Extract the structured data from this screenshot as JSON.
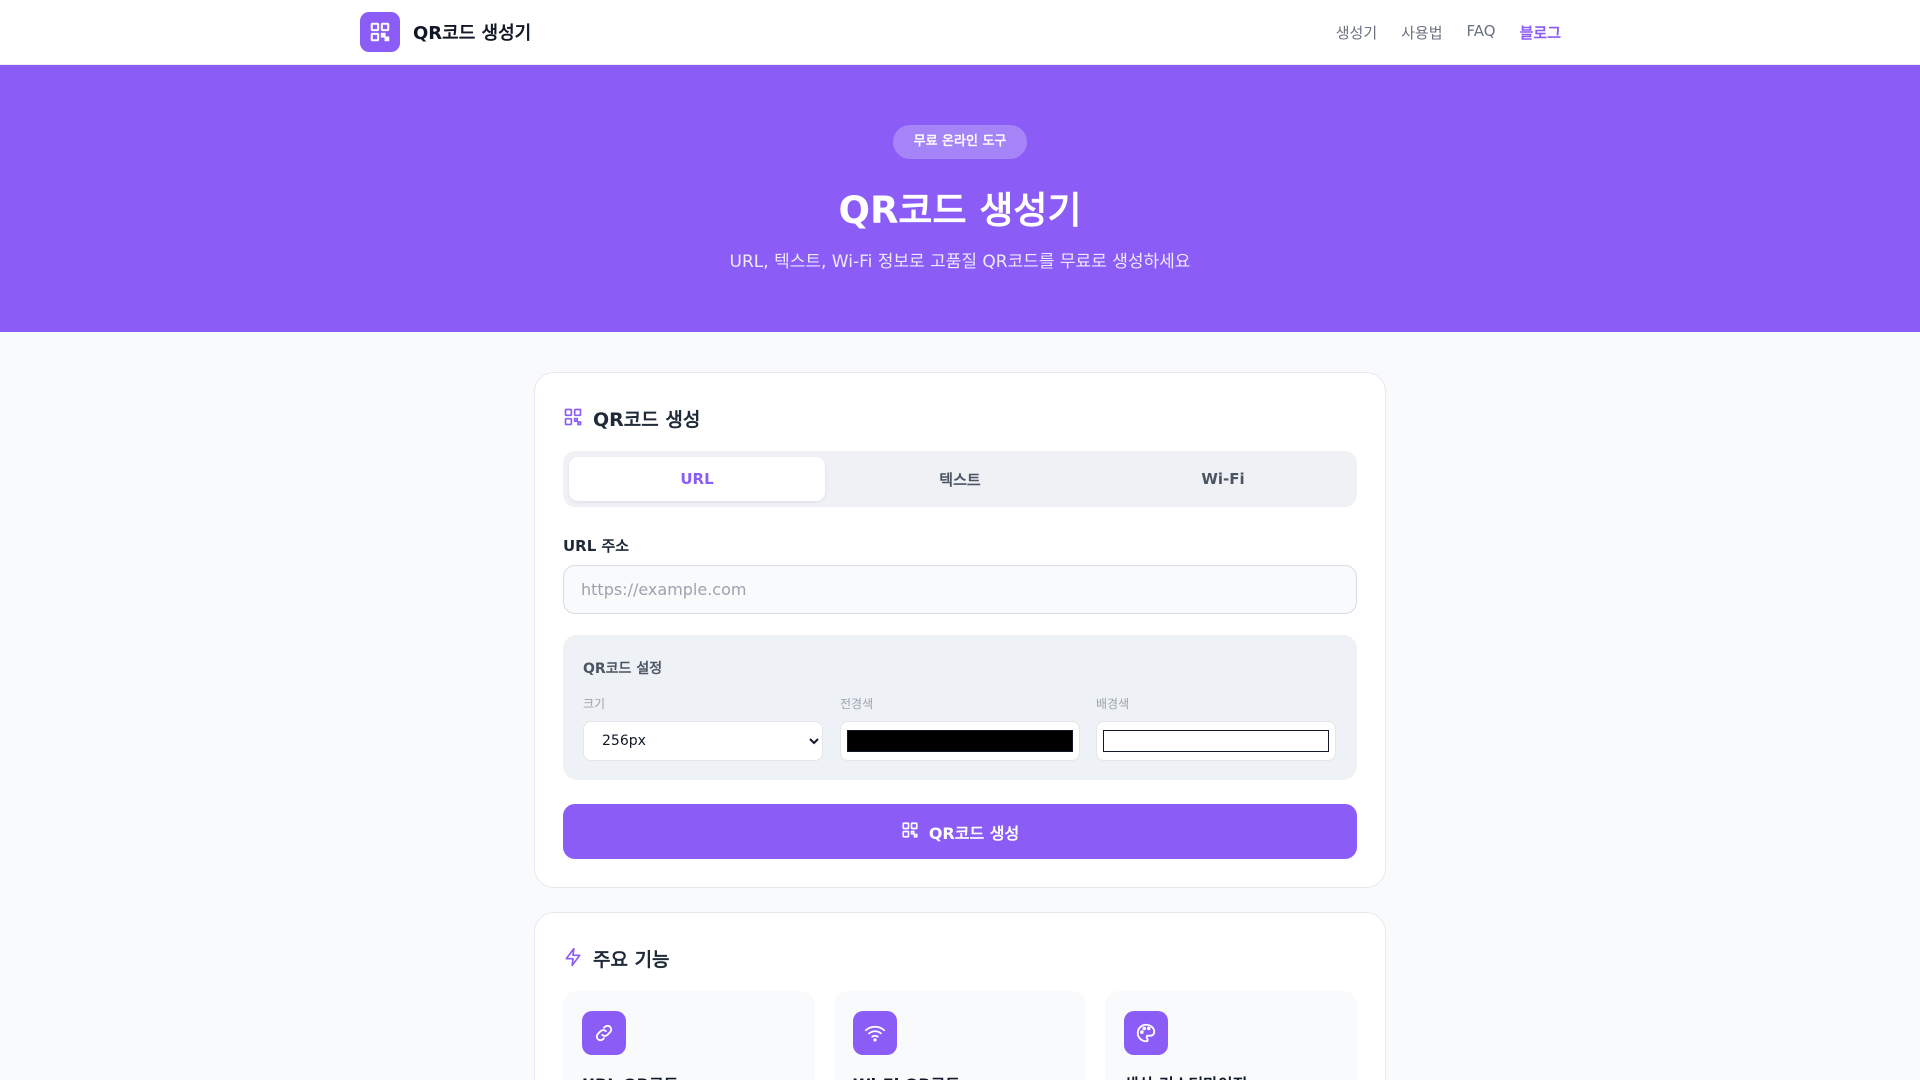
{
  "header": {
    "brand": "QR코드 생성기",
    "nav": [
      "생성기",
      "사용법",
      "FAQ",
      "블로그"
    ]
  },
  "hero": {
    "badge": "무료 온라인 도구",
    "title": "QR코드 생성기",
    "subtitle": "URL, 텍스트, Wi-Fi 정보로 고품질 QR코드를 무료로 생성하세요"
  },
  "generator": {
    "title": "QR코드 생성",
    "tabs": [
      "URL",
      "텍스트",
      "Wi-Fi"
    ],
    "active_tab": "URL",
    "url_label": "URL 주소",
    "url_placeholder": "https://example.com",
    "settings": {
      "title": "QR코드 설정",
      "size_label": "크기",
      "size_value": "256px",
      "fg_label": "전경색",
      "fg_color": "#000000",
      "bg_label": "배경색",
      "bg_color": "#ffffff"
    },
    "button": "QR코드 생성"
  },
  "features": {
    "title": "주요 기능",
    "items": [
      {
        "name": "URL QR코드",
        "icon": "link-icon"
      },
      {
        "name": "Wi-Fi QR코드",
        "icon": "wifi-icon"
      },
      {
        "name": "색상 커스터마이징",
        "icon": "palette-icon"
      }
    ]
  },
  "colors": {
    "accent": "#8b5cf6",
    "page_bg": "#f8fafc"
  }
}
